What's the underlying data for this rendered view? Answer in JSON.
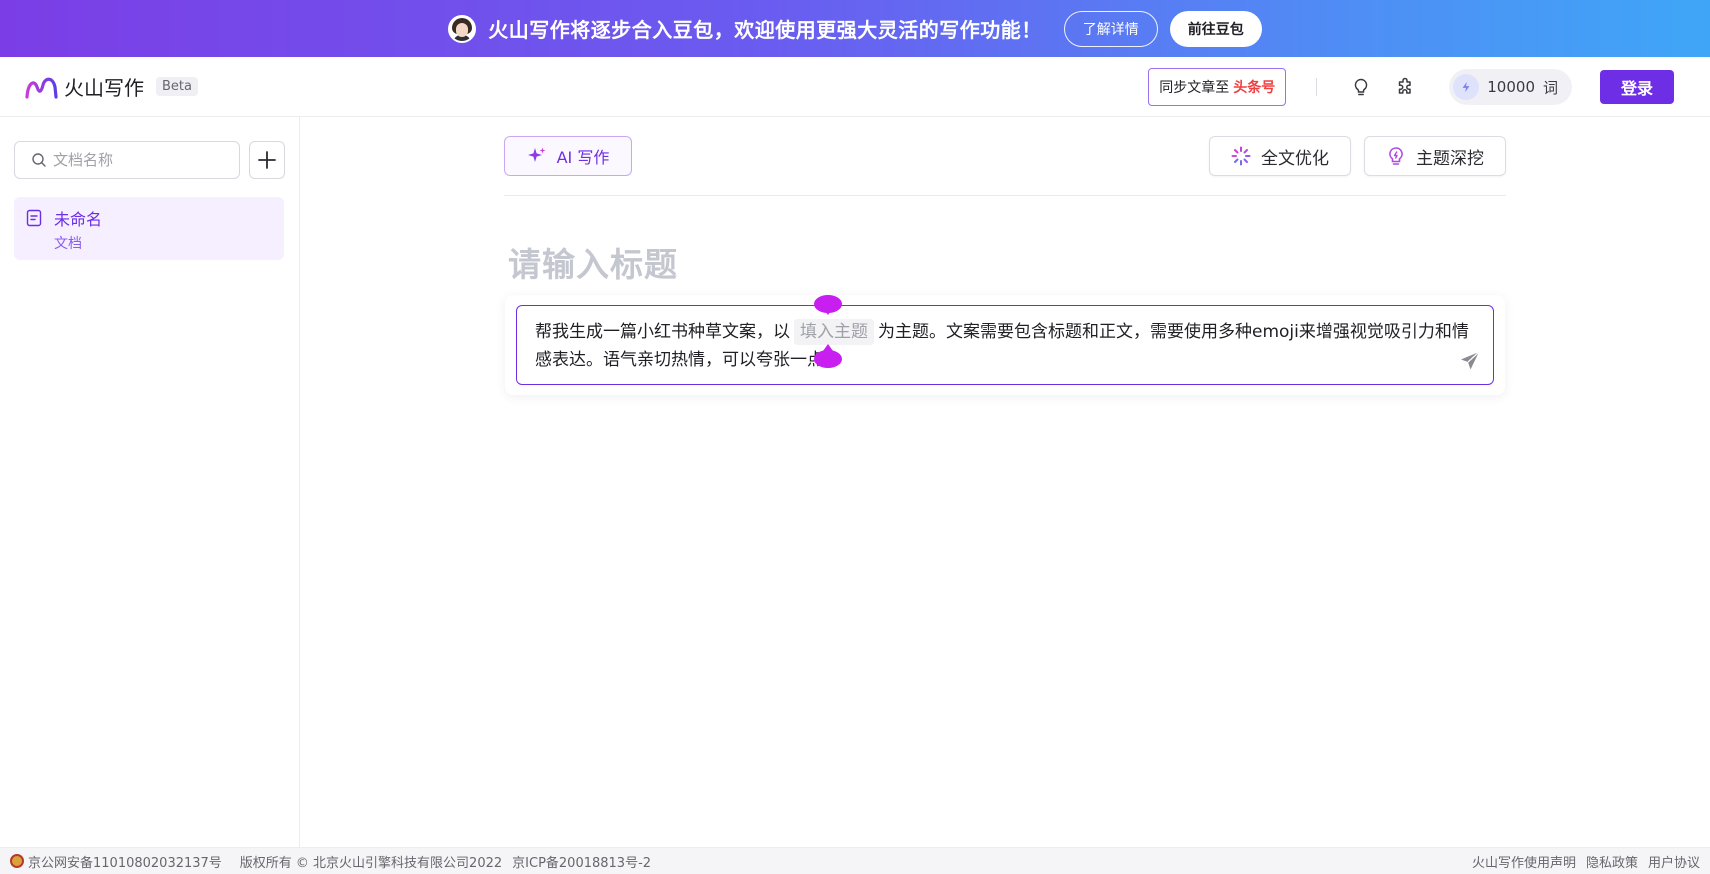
{
  "banner": {
    "message": "火山写作将逐步合入豆包，欢迎使用更强大灵活的写作功能！",
    "learn_more": "了解详情",
    "go_doubao": "前往豆包"
  },
  "header": {
    "app_name": "火山写作",
    "beta": "Beta",
    "sync_label": "同步文章至",
    "sync_target": "头条号",
    "quota_value": "10000",
    "quota_unit": "词",
    "login": "登录"
  },
  "sidebar": {
    "search_placeholder": "文档名称",
    "documents": [
      {
        "title": "未命名",
        "subtitle": "文档"
      }
    ]
  },
  "toolbar": {
    "ai_write": "AI 写作",
    "optimize": "全文优化",
    "topic_dig": "主题深挖"
  },
  "editor": {
    "title_placeholder": "请输入标题",
    "prompt_before": "帮我生成一篇小红书种草文案，以",
    "prompt_slot": "填入主题",
    "prompt_after": "为主题。文案需要包含标题和正文，需要使用多种emoji来增强视觉吸引力和情感表达。语气亲切热情，可以夸张一点。"
  },
  "footer": {
    "police_record": "京公网安备11010802032137号",
    "copyright": "版权所有 © 北京火山引擎科技有限公司2022",
    "icp": "京ICP备20018813号-2",
    "statement": "火山写作使用声明",
    "privacy": "隐私政策",
    "agreement": "用户协议"
  },
  "colors": {
    "brand_purple": "#6d2ee6",
    "toutiao_red": "#f04142",
    "handle_magenta": "#c81ff0"
  }
}
